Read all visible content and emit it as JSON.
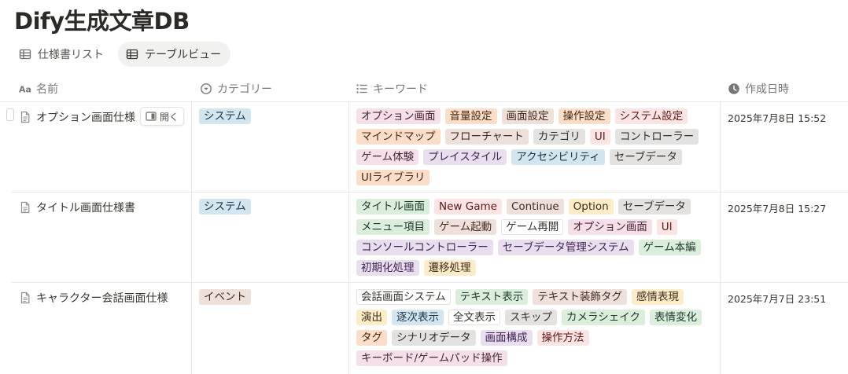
{
  "page": {
    "title": "Dify生成文章DB"
  },
  "tabs": [
    {
      "label": "仕様書リスト",
      "icon": "table-icon"
    },
    {
      "label": "テーブルビュー",
      "icon": "table-icon"
    }
  ],
  "columns": [
    {
      "label": "名前",
      "icon": "text-property-icon"
    },
    {
      "label": "カテゴリー",
      "icon": "select-property-icon"
    },
    {
      "label": "キーワード",
      "icon": "multi-select-property-icon"
    },
    {
      "label": "作成日時",
      "icon": "clock-icon"
    }
  ],
  "open_label": "開く",
  "tag_colors": {
    "red": {
      "bg": "#fbe4e4",
      "fg": "#5d1715"
    },
    "orange": {
      "bg": "#fadec9",
      "fg": "#49290e"
    },
    "brown": {
      "bg": "#eee0da",
      "fg": "#442a1e"
    },
    "yellow": {
      "bg": "#fdecc8",
      "fg": "#402c1b"
    },
    "green": {
      "bg": "#dbeddb",
      "fg": "#1c3829"
    },
    "blue": {
      "bg": "#d3e5ef",
      "fg": "#183347"
    },
    "purple": {
      "bg": "#e8deee",
      "fg": "#412454"
    },
    "pink": {
      "bg": "#f5e0e9",
      "fg": "#4c2337"
    },
    "gray": {
      "bg": "#e3e2e0",
      "fg": "#32302c"
    }
  },
  "rows": [
    {
      "name": "オプション画面仕様",
      "category": {
        "label": "システム",
        "color": "blue"
      },
      "keywords": [
        {
          "label": "オプション画面",
          "color": "pink"
        },
        {
          "label": "音量設定",
          "color": "orange"
        },
        {
          "label": "画面設定",
          "color": "brown"
        },
        {
          "label": "操作設定",
          "color": "orange"
        },
        {
          "label": "システム設定",
          "color": "red"
        },
        {
          "label": "マインドマップ",
          "color": "orange"
        },
        {
          "label": "フローチャート",
          "color": "brown"
        },
        {
          "label": "カテゴリ",
          "color": "gray"
        },
        {
          "label": "UI",
          "color": "red"
        },
        {
          "label": "コントローラー",
          "color": "gray"
        },
        {
          "label": "ゲーム体験",
          "color": "pink"
        },
        {
          "label": "プレイスタイル",
          "color": "purple"
        },
        {
          "label": "アクセシビリティ",
          "color": "blue"
        },
        {
          "label": "セーブデータ",
          "color": "gray"
        },
        {
          "label": "UIライブラリ",
          "color": "orange"
        }
      ],
      "created": "2025年7月8日 15:52"
    },
    {
      "name": "タイトル画面仕様書",
      "category": {
        "label": "システム",
        "color": "blue"
      },
      "keywords": [
        {
          "label": "タイトル画面",
          "color": "green"
        },
        {
          "label": "New Game",
          "color": "red"
        },
        {
          "label": "Continue",
          "color": "brown"
        },
        {
          "label": "Option",
          "color": "yellow"
        },
        {
          "label": "セーブデータ",
          "color": "gray"
        },
        {
          "label": "メニュー項目",
          "color": "green"
        },
        {
          "label": "ゲーム起動",
          "color": "brown"
        },
        {
          "label": "ゲーム再開",
          "color": "default"
        },
        {
          "label": "オプション画面",
          "color": "pink"
        },
        {
          "label": "UI",
          "color": "red"
        },
        {
          "label": "コンソールコントローラー",
          "color": "purple"
        },
        {
          "label": "セーブデータ管理システム",
          "color": "purple"
        },
        {
          "label": "ゲーム本編",
          "color": "green"
        },
        {
          "label": "初期化処理",
          "color": "purple"
        },
        {
          "label": "遷移処理",
          "color": "yellow"
        }
      ],
      "created": "2025年7月8日 15:27"
    },
    {
      "name": "キャラクター会話画面仕様",
      "category": {
        "label": "イベント",
        "color": "brown"
      },
      "keywords": [
        {
          "label": "会話画面システム",
          "color": "default"
        },
        {
          "label": "テキスト表示",
          "color": "green"
        },
        {
          "label": "テキスト装飾タグ",
          "color": "brown"
        },
        {
          "label": "感情表現",
          "color": "yellow"
        },
        {
          "label": "演出",
          "color": "yellow"
        },
        {
          "label": "逐次表示",
          "color": "blue"
        },
        {
          "label": "全文表示",
          "color": "default"
        },
        {
          "label": "スキップ",
          "color": "gray"
        },
        {
          "label": "カメラシェイク",
          "color": "green"
        },
        {
          "label": "表情変化",
          "color": "green"
        },
        {
          "label": "タグ",
          "color": "orange"
        },
        {
          "label": "シナリオデータ",
          "color": "gray"
        },
        {
          "label": "画面構成",
          "color": "purple"
        },
        {
          "label": "操作方法",
          "color": "red"
        },
        {
          "label": "キーボード/ゲームパッド操作",
          "color": "pink"
        }
      ],
      "created": "2025年7月7日 23:51"
    }
  ]
}
